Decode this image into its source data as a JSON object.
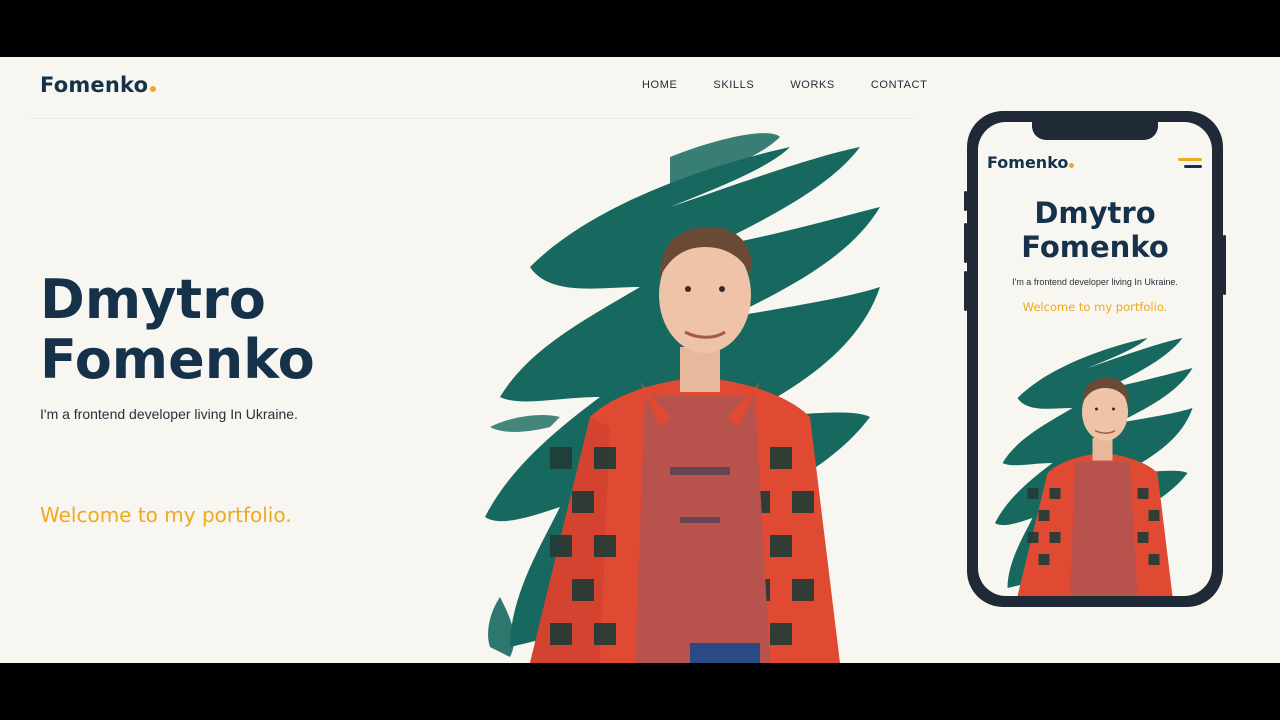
{
  "brand": {
    "name": "Fomenko"
  },
  "nav": {
    "items": [
      "HOME",
      "SKILLS",
      "WORKS",
      "CONTACT"
    ]
  },
  "hero": {
    "first_name": "Dmytro",
    "last_name": "Fomenko",
    "subtitle": "I'm a frontend developer living In Ukraine.",
    "welcome": "Welcome to my portfolio."
  },
  "mobile": {
    "brand": "Fomenko",
    "first_name": "Dmytro",
    "last_name": "Fomenko",
    "subtitle": "I'm a frontend developer living In Ukraine.",
    "welcome": "Welcome to my portfolio."
  },
  "icons": {
    "brand_dot": "dot-icon",
    "menu": "hamburger-menu-icon",
    "portrait": "portrait-photo"
  },
  "colors": {
    "primary": "#16324a",
    "accent": "#f2a81d",
    "background": "#f8f6f1",
    "brush": "#17695f",
    "shirt_red": "#e04a33",
    "shirt_dark": "#1f3b36",
    "tshirt": "#b8524c"
  }
}
